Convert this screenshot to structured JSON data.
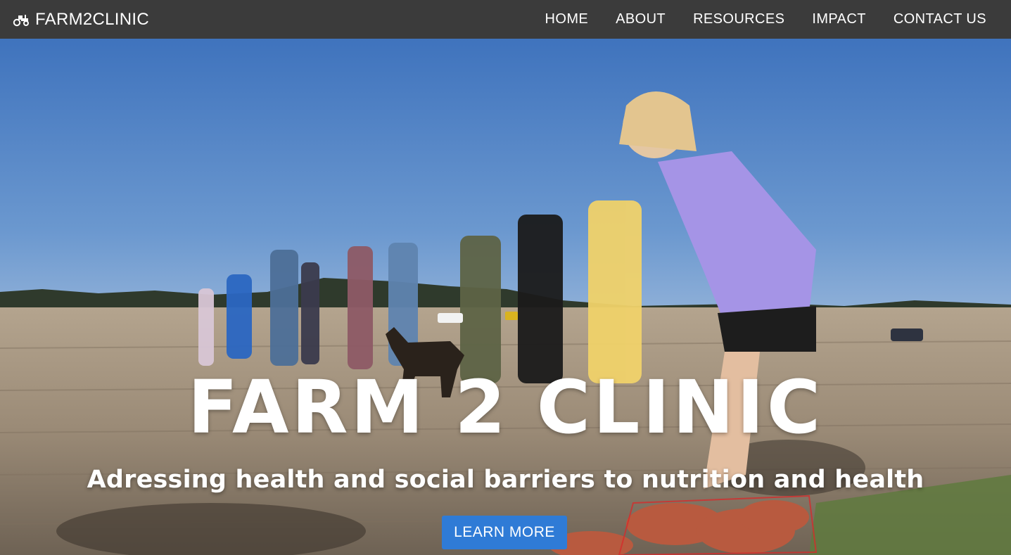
{
  "nav": {
    "brand_text": "FARM2CLINIC",
    "brand_icon": "tractor-icon",
    "links": [
      "HOME",
      "ABOUT",
      "RESOURCES",
      "IMPACT",
      "CONTACT US"
    ]
  },
  "hero": {
    "title": "FARM 2 CLINIC",
    "subtitle": "Adressing health and social barriers to nutrition and health",
    "cta_label": "LEARN MORE"
  },
  "colors": {
    "navbar": "#3b3b3b",
    "cta": "#2f7bd6",
    "sky": "#4a7fc4",
    "field": "#9a8a78"
  }
}
